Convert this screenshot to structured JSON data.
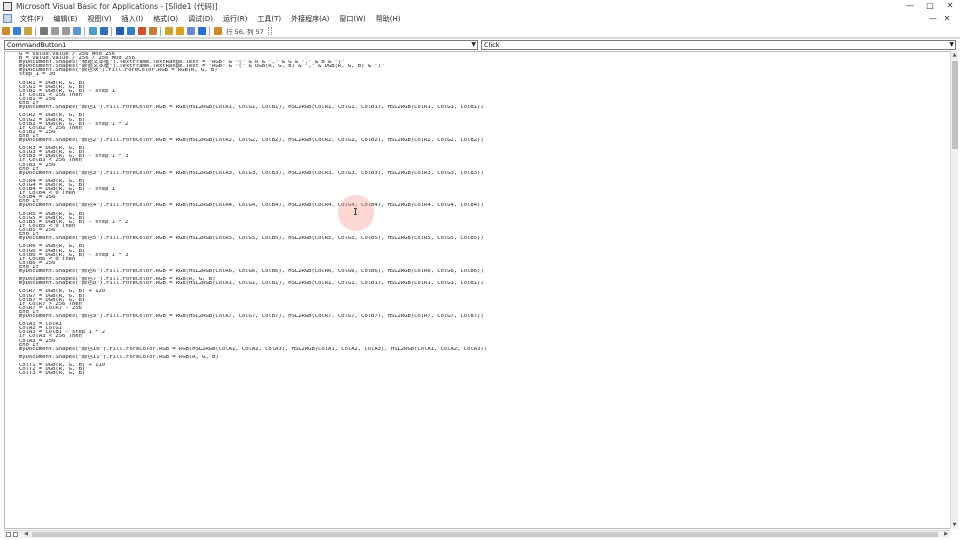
{
  "window": {
    "title": "Microsoft Visual Basic for Applications - [Slide1 (代码)]",
    "controls": [
      "—",
      "□",
      "✕"
    ]
  },
  "menubar": {
    "items": [
      "文件(F)",
      "编辑(E)",
      "视图(V)",
      "插入(I)",
      "格式(O)",
      "调试(D)",
      "运行(R)",
      "工具(T)",
      "外接程序(A)",
      "窗口(W)",
      "帮助(H)"
    ],
    "mdi_controls": [
      "—",
      "✕"
    ]
  },
  "toolbar": {
    "position_text": "行 56, 列 57"
  },
  "object_combo": {
    "value": "CommandButton1"
  },
  "procedure_combo": {
    "value": "Click"
  },
  "code": {
    "lines": [
      "G = value.value / 256 Mod 256",
      "B = value.value / 256 / 256 Mod 256",
      "myDocument.Shapes(\"标题文本框\").TextFrame.TextRange.Text = \"RGB\" & \"(\" & R & \",\" & G & \",\" & B & \")\"",
      "myDocument.Shapes(\"数值文本框\").TextFrame.TextRange.Text = \"RGB\" & \"(\" & DGB(R, G, B) & \",\" & DGB(R, G, B) & \")\"",
      "myDocument.Shapes(\"颜色块\").Fill.ForeColor.RGB = RGB(R, G, B)",
      "step_1 = 30",
      "",
      "ColR1 = DGB(R, G, B)",
      "ColG1 = DGB(R, G, B)",
      "ColB1 = DGB(R, G, B) - step_1",
      "If ColB1 < 256 Then",
      "ColB1 = 256",
      "End If",
      "myDocument.Shapes(\"颜色1\").Fill.ForeColor.RGB = RGB(HSL2RGB(ColR1, ColG1, ColB1), HSL2RGB(ColR1, ColG1, ColB1), HSL2RGB(ColR1, ColG1, ColB1))",
      "",
      "ColR2 = DGB(R, G, B)",
      "ColG2 = DGB(R, G, B)",
      "ColB2 = DGB(R, G, B) - step_1 * 2",
      "If ColB2 < 256 Then",
      "ColB2 = 256",
      "End If",
      "myDocument.Shapes(\"颜色2\").Fill.ForeColor.RGB = RGB(HSL2RGB(ColR2, ColG2, ColB2), HSL2RGB(ColR2, ColG2, ColB2), HSL2RGB(ColR2, ColG2, ColB2))",
      "",
      "ColR3 = DGB(R, G, B)",
      "ColG3 = DGB(R, G, B)",
      "ColB3 = DGB(R, G, B) - step_1 * 3",
      "If ColB3 < 256 Then",
      "ColB3 = 256",
      "End If",
      "myDocument.Shapes(\"颜色3\").Fill.ForeColor.RGB = RGB(HSL2RGB(ColR3, ColG3, ColB3), HSL2RGB(ColR3, ColG3, ColB3), HSL2RGB(ColR3, ColG3, ColB3))",
      "",
      "ColR4 = DGB(R, G, B)",
      "ColG4 = DGB(R, G, B)",
      "ColB4 = DGB(R, G, B) - step_1",
      "If ColB4 < 0 Then",
      "ColB4 = 256",
      "End If",
      "myDocument.Shapes(\"颜色4\").Fill.ForeColor.RGB = RGB(HSL2RGB(ColR4, ColG4, ColB4), HSL2RGB(ColR4, ColG4, ColB4), HSL2RGB(ColR4, ColG4, ColB4))",
      "",
      "ColR5 = DGB(R, G, B)",
      "ColG5 = DGB(R, G, B)",
      "ColB5 = DGB(R, G, B) - step_1 * 2",
      "If ColB5 < 0 Then",
      "ColB5 = 256",
      "End If",
      "myDocument.Shapes(\"颜色5\").Fill.ForeColor.RGB = RGB(HSL2RGB(ColR5, ColG5, ColB5), HSL2RGB(ColR5, ColG5, ColB5), HSL2RGB(ColR5, ColG5, ColB5))",
      "",
      "ColR6 = DGB(R, G, B)",
      "ColG6 = DGB(R, G, B)",
      "ColB6 = DGB(R, G, B) - step_1 * 3",
      "If ColB6 < 0 Then",
      "ColB6 = 256",
      "End If",
      "myDocument.Shapes(\"颜色6\").Fill.ForeColor.RGB = RGB(HSL2RGB(ColR6, ColG6, ColB6), HSL2RGB(ColR6, ColG6, ColB6), HSL2RGB(ColR6, ColG6, ColB6))",
      "",
      "myDocument.Shapes(\"颜色7\").Fill.ForeColor.RGB = RGB(R, G, B)",
      "myDocument.Shapes(\"颜色8\").Fill.ForeColor.RGB = RGB(HSL2RGB(ColR1, ColG1, ColB1), HSL2RGB(ColR1, ColG1, ColB1), HSL2RGB(ColR1, ColG1, ColB1))",
      "",
      "ColR7 = DGB(R, G, B) + 120",
      "ColG7 = DGB(R, G, B)",
      "ColB7 = DGB(R, G, B)",
      "If ColR7 > 256 Then",
      "ColR7 = ColR7 - 256",
      "End If",
      "myDocument.Shapes(\"颜色9\").Fill.ForeColor.RGB = RGB(HSL2RGB(ColR7, ColG7, ColB7), HSL2RGB(ColR7, ColG7, ColB7), HSL2RGB(ColR7, ColG7, ColB7))",
      "",
      "ColA1 = ColR1",
      "ColA2 = ColG1",
      "ColA3 = ColB1 - step_1 * 2",
      "If ColA3 < 256 Then",
      "ColA3 = 256",
      "End If",
      "myDocument.Shapes(\"颜色10\").Fill.ForeColor.RGB = RGB(HSL2RGB(ColA1, ColA2, ColA3), HSL2RGB(ColA1, ColA2, ColA3), HSL2RGB(ColA1, ColA2, ColA3))",
      "",
      "myDocument.Shapes(\"颜色11\").Fill.ForeColor.RGB = RGB(R, G, B)",
      "",
      "ColT1 = DGB(R, G, B) + 110",
      "ColT2 = DGB(R, G, B)",
      "ColT3 = DGB(R, G, B)"
    ]
  },
  "colors": {
    "toolbar_icons": [
      "#d08a2a",
      "#3a7fd0",
      "#c9a43a",
      "#777777",
      "#9a9a9a",
      "#9a9a9a",
      "#5f95d8",
      "#4aa0c8",
      "#2a6fc0",
      "#1f5fb0",
      "#3480c8",
      "#d05030",
      "#c08030",
      "#d0a030",
      "#e0a020",
      "#6a88d0",
      "#2a70d0"
    ],
    "cursor_halo": "#fa968c"
  }
}
